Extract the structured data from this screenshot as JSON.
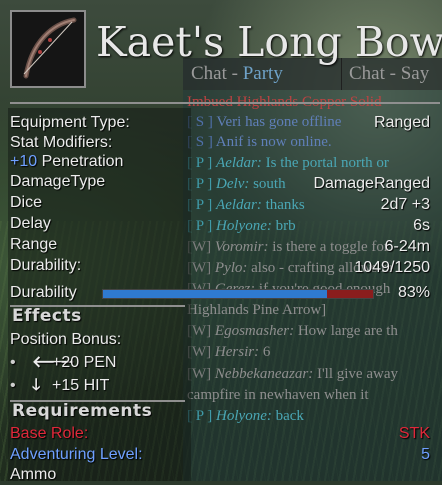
{
  "item": {
    "name": "Kaet's Long Bow",
    "icon": "bow-icon"
  },
  "chat": {
    "tabs": [
      {
        "prefix": "Chat - ",
        "accent": "Party"
      },
      {
        "prefix": "Chat - Say",
        "accent": ""
      }
    ],
    "lines": [
      {
        "channel": "",
        "name": "",
        "msg": "Imbued Highlands Copper Solid",
        "type": "r"
      },
      {
        "channel": "[ S ]",
        "name": "",
        "msg": "Veri has gone offline",
        "type": "s"
      },
      {
        "channel": "[ S ]",
        "name": "",
        "msg": "Anif is now online.",
        "type": "s"
      },
      {
        "channel": "[ P ]",
        "name": "Aeldar:",
        "msg": " Is the portal north or",
        "type": "p"
      },
      {
        "channel": "[ P ]",
        "name": "Delv:",
        "msg": " south",
        "type": "p"
      },
      {
        "channel": "[ P ]",
        "name": "Aeldar:",
        "msg": " thanks",
        "type": "p"
      },
      {
        "channel": "[ P ]",
        "name": "Holyone:",
        "msg": " brb",
        "type": "p"
      },
      {
        "channel": "[W]",
        "name": "Voromir:",
        "msg": " is there a toggle for",
        "type": "w"
      },
      {
        "channel": "[W]",
        "name": "Pylo:",
        "msg": " also - crafting allows ra",
        "type": "w"
      },
      {
        "channel": "[W]",
        "name": "Gerez:",
        "msg": " if you're good enough",
        "type": "w"
      },
      {
        "channel": "",
        "name": "",
        "msg": "Highlands Pine Arrow]",
        "type": "w"
      },
      {
        "channel": "[W]",
        "name": "Egosmasher:",
        "msg": " How large are th",
        "type": "w"
      },
      {
        "channel": "[W]",
        "name": "Hersir:",
        "msg": " 6",
        "type": "w"
      },
      {
        "channel": "[W]",
        "name": "Nebbekaneazar:",
        "msg": " I'll give away",
        "type": "w"
      },
      {
        "channel": "",
        "name": "",
        "msg": "campfire in newhaven when it",
        "type": "w"
      },
      {
        "channel": "[ P ]",
        "name": "Holyone:",
        "msg": " back",
        "type": "p"
      }
    ]
  },
  "stats": {
    "equipment_type_label": "Equipment Type:",
    "equipment_type_value": "Ranged",
    "stat_modifiers_label": "Stat Modifiers:",
    "modifier_amount": "+10",
    "modifier_stat": " Penetration",
    "damage_type_label": "DamageType",
    "damage_type_value": "DamageRanged",
    "dice_label": "Dice",
    "dice_value": "2d7 +3",
    "delay_label": "Delay",
    "delay_value": "6s",
    "range_label": "Range",
    "range_value": "6-24m",
    "durability_label": "Durability:",
    "durability_value": "1049/1250",
    "durability_bar_label": "Durability",
    "durability_percent_text": "83%",
    "durability_fraction": 0.83
  },
  "effects": {
    "heading": "Effects",
    "position_bonus_label": "Position Bonus:",
    "bonuses": [
      {
        "bullet": "•",
        "arrow": "🡐",
        "arrow_icon": "arrow-left-icon",
        "text": "+20 PEN"
      },
      {
        "bullet": "•",
        "arrow": "🡓",
        "arrow_icon": "arrow-down-icon",
        "text": "+15 HIT"
      }
    ]
  },
  "requirements": {
    "heading": "Requirements",
    "base_role_label": "Base Role:",
    "base_role_value": "STK",
    "adventuring_level_label": "Adventuring Level:",
    "adventuring_level_value": "5",
    "ammo_label": "Ammo"
  },
  "colors": {
    "blue_text": "#6fa0ff",
    "red_text": "#e0283a",
    "bar_fill": "#2f7ad0",
    "bar_rest": "#8a1d1d"
  }
}
